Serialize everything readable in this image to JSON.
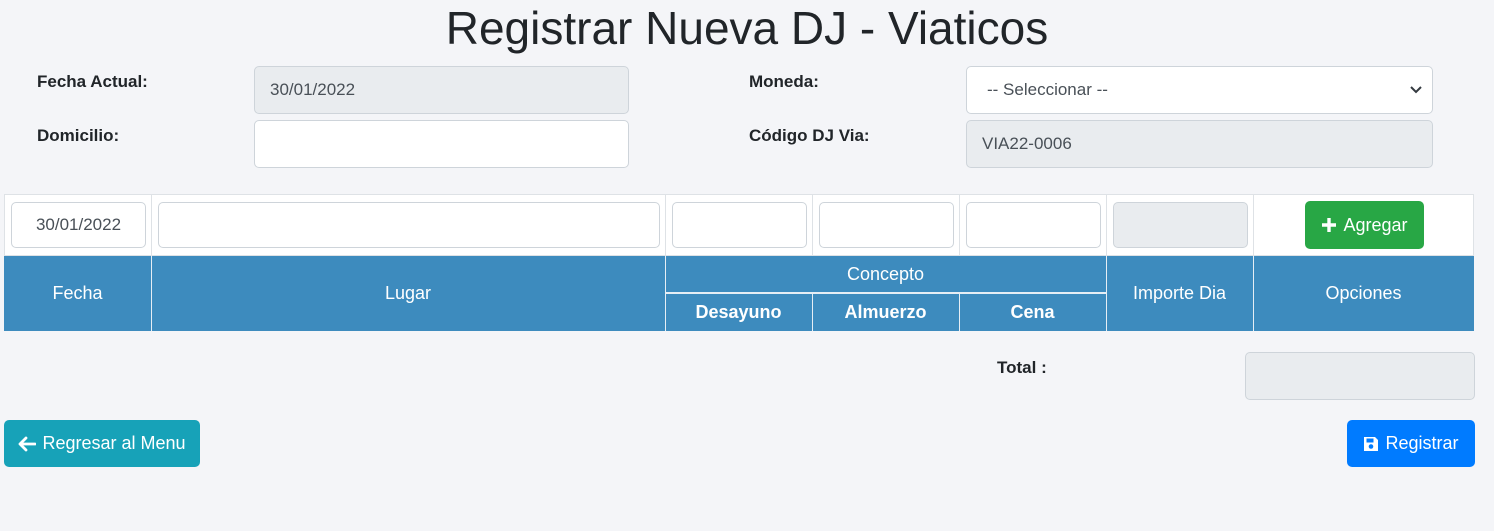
{
  "page": {
    "title": "Registrar Nueva DJ - Viaticos"
  },
  "form": {
    "fecha_actual_label": "Fecha Actual:",
    "fecha_actual_value": "30/01/2022",
    "domicilio_label": "Domicilio:",
    "domicilio_value": "",
    "moneda_label": "Moneda:",
    "moneda_selected": "-- Seleccionar --",
    "codigo_label": "Código DJ Via:",
    "codigo_value": "VIA22-0006"
  },
  "entry": {
    "fecha_value": "30/01/2022",
    "lugar_value": "",
    "desayuno_value": "",
    "almuerzo_value": "",
    "cena_value": "",
    "importe_value": "",
    "add_label": "Agregar"
  },
  "table": {
    "headers": {
      "fecha": "Fecha",
      "lugar": "Lugar",
      "concepto": "Concepto",
      "desayuno": "Desayuno",
      "almuerzo": "Almuerzo",
      "cena": "Cena",
      "importe": "Importe Dia",
      "opciones": "Opciones"
    },
    "rows": []
  },
  "footer": {
    "total_label": "Total :",
    "total_value": "",
    "back_label": "Regresar al Menu",
    "register_label": "Registrar"
  },
  "colors": {
    "header_bg": "#3d8bbe",
    "add_button": "#28a745",
    "back_button": "#17a2b8",
    "register_button": "#007bff"
  },
  "icons": {
    "add": "plus-icon",
    "back": "arrow-left-icon",
    "register": "save-icon",
    "select": "chevron-down-icon"
  }
}
